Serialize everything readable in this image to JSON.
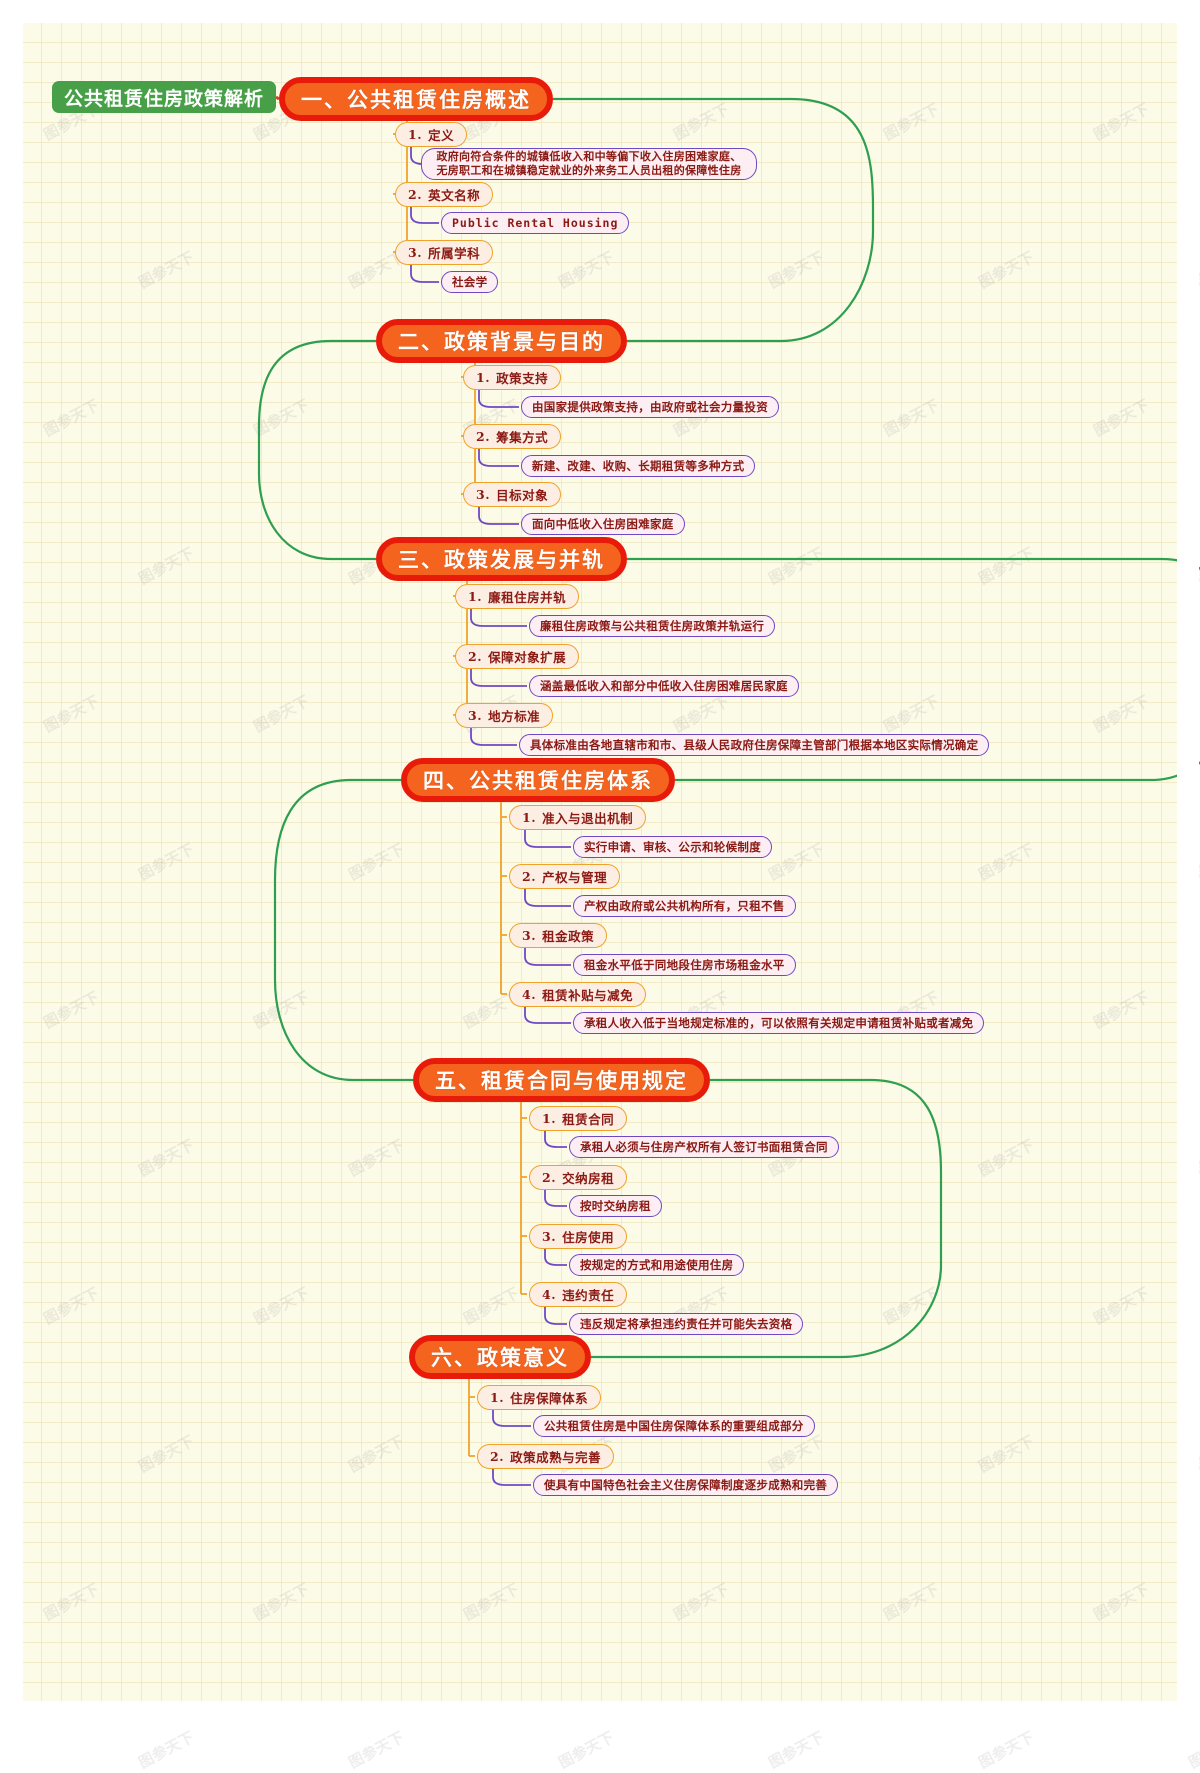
{
  "title": "公共租赁住房政策解析",
  "watermark": "图参天下",
  "colors": {
    "root_fill": "#47a048",
    "chapter_fill": "#f4641e",
    "chapter_ring": "#e81b0a",
    "topic_border": "#f0a32a",
    "topic_fill": "#fdeee4",
    "leaf_border": "#6e49c6",
    "leaf_fill": "#fceef2",
    "trunk_link": "#2e9e4f",
    "topic_link": "#f0a32a",
    "leaf_link": "#6e49c6",
    "text_dark": "#8b1a14",
    "page_bg": "#fcfbe8"
  },
  "chapters": [
    {
      "label": "一、公共租赁住房概述",
      "topics": [
        {
          "num": "1.",
          "label": "定义",
          "leaves": [
            {
              "text": "政府向符合条件的城镇低收入和中等偏下收入住房困难家庭、无房职工和在城镇稳定就业的外来务工人员出租的保障性住房",
              "lines": 2
            }
          ]
        },
        {
          "num": "2.",
          "label": "英文名称",
          "leaves": [
            {
              "text": "Public Rental Housing",
              "mono": true
            }
          ]
        },
        {
          "num": "3.",
          "label": "所属学科",
          "leaves": [
            {
              "text": "社会学"
            }
          ]
        }
      ]
    },
    {
      "label": "二、政策背景与目的",
      "topics": [
        {
          "num": "1.",
          "label": "政策支持",
          "leaves": [
            {
              "text": "由国家提供政策支持，由政府或社会力量投资"
            }
          ]
        },
        {
          "num": "2.",
          "label": "筹集方式",
          "leaves": [
            {
              "text": "新建、改建、收购、长期租赁等多种方式"
            }
          ]
        },
        {
          "num": "3.",
          "label": "目标对象",
          "leaves": [
            {
              "text": "面向中低收入住房困难家庭"
            }
          ]
        }
      ]
    },
    {
      "label": "三、政策发展与并轨",
      "topics": [
        {
          "num": "1.",
          "label": "廉租住房并轨",
          "leaves": [
            {
              "text": "廉租住房政策与公共租赁住房政策并轨运行"
            }
          ]
        },
        {
          "num": "2.",
          "label": "保障对象扩展",
          "leaves": [
            {
              "text": "涵盖最低收入和部分中低收入住房困难居民家庭"
            }
          ]
        },
        {
          "num": "3.",
          "label": "地方标准",
          "leaves": [
            {
              "text": "具体标准由各地直辖市和市、县级人民政府住房保障主管部门根据本地区实际情况确定"
            }
          ]
        }
      ]
    },
    {
      "label": "四、公共租赁住房体系",
      "topics": [
        {
          "num": "1.",
          "label": "准入与退出机制",
          "leaves": [
            {
              "text": "实行申请、审核、公示和轮候制度"
            }
          ]
        },
        {
          "num": "2.",
          "label": "产权与管理",
          "leaves": [
            {
              "text": "产权由政府或公共机构所有，只租不售"
            }
          ]
        },
        {
          "num": "3.",
          "label": "租金政策",
          "leaves": [
            {
              "text": "租金水平低于同地段住房市场租金水平"
            }
          ]
        },
        {
          "num": "4.",
          "label": "租赁补贴与减免",
          "leaves": [
            {
              "text": "承租人收入低于当地规定标准的，可以依照有关规定申请租赁补贴或者减免"
            }
          ]
        }
      ]
    },
    {
      "label": "五、租赁合同与使用规定",
      "topics": [
        {
          "num": "1.",
          "label": "租赁合同",
          "leaves": [
            {
              "text": "承租人必须与住房产权所有人签订书面租赁合同"
            }
          ]
        },
        {
          "num": "2.",
          "label": "交纳房租",
          "leaves": [
            {
              "text": "按时交纳房租"
            }
          ]
        },
        {
          "num": "3.",
          "label": "住房使用",
          "leaves": [
            {
              "text": "按规定的方式和用途使用住房"
            }
          ]
        },
        {
          "num": "4.",
          "label": "违约责任",
          "leaves": [
            {
              "text": "违反规定将承担违约责任并可能失去资格"
            }
          ]
        }
      ]
    },
    {
      "label": "六、政策意义",
      "topics": [
        {
          "num": "1.",
          "label": "住房保障体系",
          "leaves": [
            {
              "text": "公共租赁住房是中国住房保障体系的重要组成部分"
            }
          ]
        },
        {
          "num": "2.",
          "label": "政策成熟与完善",
          "leaves": [
            {
              "text": "使具有中国特色社会主义住房保障制度逐步成熟和完善"
            }
          ]
        }
      ]
    }
  ]
}
